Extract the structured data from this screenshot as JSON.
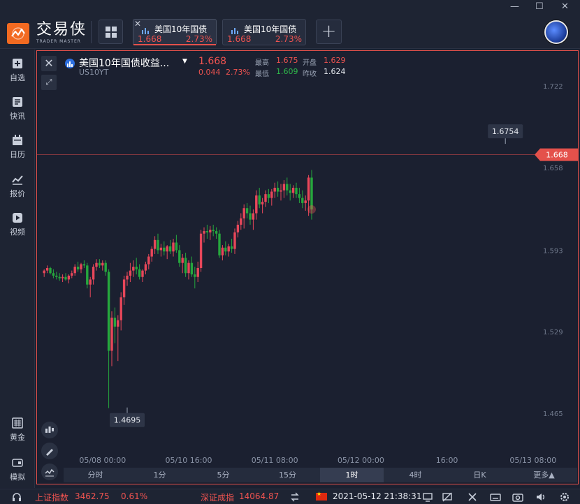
{
  "app": {
    "logo_cn": "交易侠",
    "logo_en": "TRADER MASTER"
  },
  "tabs": [
    {
      "title": "美国10年国债",
      "price": "1.668",
      "pct": "2.73%",
      "active": true
    },
    {
      "title": "美国10年国债",
      "price": "1.668",
      "pct": "2.73%",
      "active": false
    }
  ],
  "window": {
    "minimize": "—",
    "maximize": "☐",
    "close": "✕",
    "restore": "⊟"
  },
  "sidebar": {
    "items": [
      {
        "label": "自选",
        "icon": "favorite-add-icon"
      },
      {
        "label": "快讯",
        "icon": "news-icon"
      },
      {
        "label": "日历",
        "icon": "calendar-icon"
      },
      {
        "label": "报价",
        "icon": "quote-icon"
      },
      {
        "label": "视频",
        "icon": "video-icon"
      },
      {
        "label": "黄金",
        "icon": "gold-icon"
      },
      {
        "label": "模拟",
        "icon": "simulate-icon"
      }
    ]
  },
  "symbol": {
    "name": "美国10年国债收益...",
    "code": "US10YT",
    "last": "1.668",
    "change": "0.044",
    "change_pct": "2.73%",
    "high_label": "最高",
    "high": "1.675",
    "open_label": "开盘",
    "open": "1.629",
    "low_label": "最低",
    "low": "1.609",
    "prev_label": "昨收",
    "prev": "1.624"
  },
  "periods": [
    "分时",
    "1分",
    "5分",
    "15分",
    "1时",
    "4时",
    "日K",
    "更多▲"
  ],
  "active_period": "1时",
  "chart_data": {
    "type": "candlestick",
    "timeframe": "1时",
    "y_ticks": [
      "1.722",
      "1.658",
      "1.593",
      "1.529",
      "1.465"
    ],
    "y_tick_values": [
      1.722,
      1.658,
      1.593,
      1.529,
      1.465
    ],
    "ylim": [
      1.4425,
      1.733
    ],
    "x_ticks": [
      "05/08 00:00",
      "05/10 16:00",
      "05/11 08:00",
      "05/12 00:00",
      "16:00",
      "05/13 08:00"
    ],
    "x_tick_index": [
      19,
      47,
      75,
      103,
      131,
      159
    ],
    "current_price_label": "1.668",
    "current_price": 1.668,
    "high_annotation": "1.6754",
    "high_annotation_value": 1.6754,
    "high_annotation_index": 150,
    "low_annotation": "1.4695",
    "low_annotation_value": 1.4695,
    "low_annotation_index": 27,
    "ohlc": [
      [
        1.575,
        1.578,
        1.572,
        1.577
      ],
      [
        1.577,
        1.581,
        1.575,
        1.579
      ],
      [
        1.579,
        1.58,
        1.574,
        1.575
      ],
      [
        1.575,
        1.578,
        1.571,
        1.573
      ],
      [
        1.573,
        1.576,
        1.57,
        1.572
      ],
      [
        1.572,
        1.575,
        1.569,
        1.571
      ],
      [
        1.571,
        1.574,
        1.568,
        1.572
      ],
      [
        1.572,
        1.575,
        1.569,
        1.57
      ],
      [
        1.57,
        1.574,
        1.567,
        1.573
      ],
      [
        1.573,
        1.577,
        1.571,
        1.575
      ],
      [
        1.575,
        1.582,
        1.573,
        1.58
      ],
      [
        1.58,
        1.584,
        1.576,
        1.578
      ],
      [
        1.578,
        1.583,
        1.575,
        1.582
      ],
      [
        1.582,
        1.585,
        1.579,
        1.581
      ],
      [
        1.581,
        1.583,
        1.563,
        1.566
      ],
      [
        1.566,
        1.572,
        1.556,
        1.57
      ],
      [
        1.57,
        1.582,
        1.566,
        1.58
      ],
      [
        1.58,
        1.586,
        1.577,
        1.583
      ],
      [
        1.583,
        1.586,
        1.579,
        1.581
      ],
      [
        1.581,
        1.585,
        1.577,
        1.583
      ],
      [
        1.583,
        1.585,
        1.573,
        1.576
      ],
      [
        1.576,
        1.578,
        1.469,
        1.514
      ],
      [
        1.514,
        1.545,
        1.502,
        1.54
      ],
      [
        1.54,
        1.548,
        1.52,
        1.533
      ],
      [
        1.533,
        1.542,
        1.506,
        1.538
      ],
      [
        1.538,
        1.56,
        1.53,
        1.556
      ],
      [
        1.556,
        1.573,
        1.55,
        1.57
      ],
      [
        1.57,
        1.576,
        1.565,
        1.573
      ],
      [
        1.573,
        1.583,
        1.568,
        1.577
      ],
      [
        1.577,
        1.585,
        1.572,
        1.58
      ],
      [
        1.58,
        1.587,
        1.574,
        1.578
      ],
      [
        1.578,
        1.582,
        1.57,
        1.572
      ],
      [
        1.572,
        1.578,
        1.568,
        1.577
      ],
      [
        1.577,
        1.584,
        1.574,
        1.582
      ],
      [
        1.582,
        1.59,
        1.578,
        1.588
      ],
      [
        1.588,
        1.596,
        1.584,
        1.594
      ],
      [
        1.594,
        1.604,
        1.59,
        1.601
      ],
      [
        1.601,
        1.606,
        1.59,
        1.593
      ],
      [
        1.593,
        1.598,
        1.588,
        1.595
      ],
      [
        1.595,
        1.6,
        1.589,
        1.592
      ],
      [
        1.592,
        1.597,
        1.586,
        1.596
      ],
      [
        1.596,
        1.601,
        1.59,
        1.592
      ],
      [
        1.592,
        1.602,
        1.588,
        1.599
      ],
      [
        1.599,
        1.605,
        1.591,
        1.593
      ],
      [
        1.593,
        1.597,
        1.58,
        1.583
      ],
      [
        1.583,
        1.59,
        1.575,
        1.587
      ],
      [
        1.587,
        1.591,
        1.572,
        1.575
      ],
      [
        1.575,
        1.585,
        1.57,
        1.583
      ],
      [
        1.583,
        1.588,
        1.572,
        1.574
      ],
      [
        1.574,
        1.58,
        1.563,
        1.572
      ],
      [
        1.572,
        1.584,
        1.568,
        1.579
      ],
      [
        1.579,
        1.609,
        1.576,
        1.606
      ],
      [
        1.606,
        1.611,
        1.599,
        1.608
      ],
      [
        1.608,
        1.613,
        1.602,
        1.607
      ],
      [
        1.607,
        1.612,
        1.601,
        1.609
      ],
      [
        1.609,
        1.613,
        1.604,
        1.608
      ],
      [
        1.608,
        1.611,
        1.602,
        1.606
      ],
      [
        1.606,
        1.609,
        1.587,
        1.589
      ],
      [
        1.589,
        1.597,
        1.585,
        1.595
      ],
      [
        1.595,
        1.6,
        1.589,
        1.592
      ],
      [
        1.592,
        1.598,
        1.588,
        1.596
      ],
      [
        1.596,
        1.602,
        1.591,
        1.594
      ],
      [
        1.594,
        1.61,
        1.59,
        1.607
      ],
      [
        1.607,
        1.616,
        1.603,
        1.613
      ],
      [
        1.613,
        1.622,
        1.609,
        1.618
      ],
      [
        1.618,
        1.629,
        1.61,
        1.626
      ],
      [
        1.626,
        1.63,
        1.618,
        1.622
      ],
      [
        1.622,
        1.628,
        1.613,
        1.617
      ],
      [
        1.617,
        1.625,
        1.609,
        1.622
      ],
      [
        1.622,
        1.64,
        1.617,
        1.636
      ],
      [
        1.636,
        1.642,
        1.626,
        1.629
      ],
      [
        1.629,
        1.634,
        1.622,
        1.631
      ],
      [
        1.631,
        1.64,
        1.627,
        1.637
      ],
      [
        1.637,
        1.641,
        1.63,
        1.634
      ],
      [
        1.634,
        1.641,
        1.628,
        1.639
      ],
      [
        1.639,
        1.646,
        1.634,
        1.642
      ],
      [
        1.642,
        1.647,
        1.635,
        1.639
      ],
      [
        1.639,
        1.645,
        1.632,
        1.64
      ],
      [
        1.64,
        1.648,
        1.634,
        1.645
      ],
      [
        1.645,
        1.65,
        1.636,
        1.64
      ],
      [
        1.64,
        1.645,
        1.632,
        1.638
      ],
      [
        1.638,
        1.644,
        1.634,
        1.642
      ],
      [
        1.642,
        1.646,
        1.634,
        1.637
      ],
      [
        1.637,
        1.642,
        1.63,
        1.634
      ],
      [
        1.634,
        1.64,
        1.626,
        1.63
      ],
      [
        1.63,
        1.636,
        1.624,
        1.632
      ],
      [
        1.632,
        1.652,
        1.62,
        1.65
      ],
      [
        1.65,
        1.656,
        1.617,
        1.625
      ]
    ]
  },
  "status": {
    "sh_label": "上证指数",
    "sh_value": "3462.75",
    "sh_pct": "0.61%",
    "sz_label": "深证成指",
    "sz_value": "14064.87",
    "datetime": "2021-05-12 21:38:31"
  },
  "colors": {
    "up": "#e8475a",
    "down": "#26a73d",
    "accent": "#f26a21",
    "bg": "#1b2030"
  }
}
